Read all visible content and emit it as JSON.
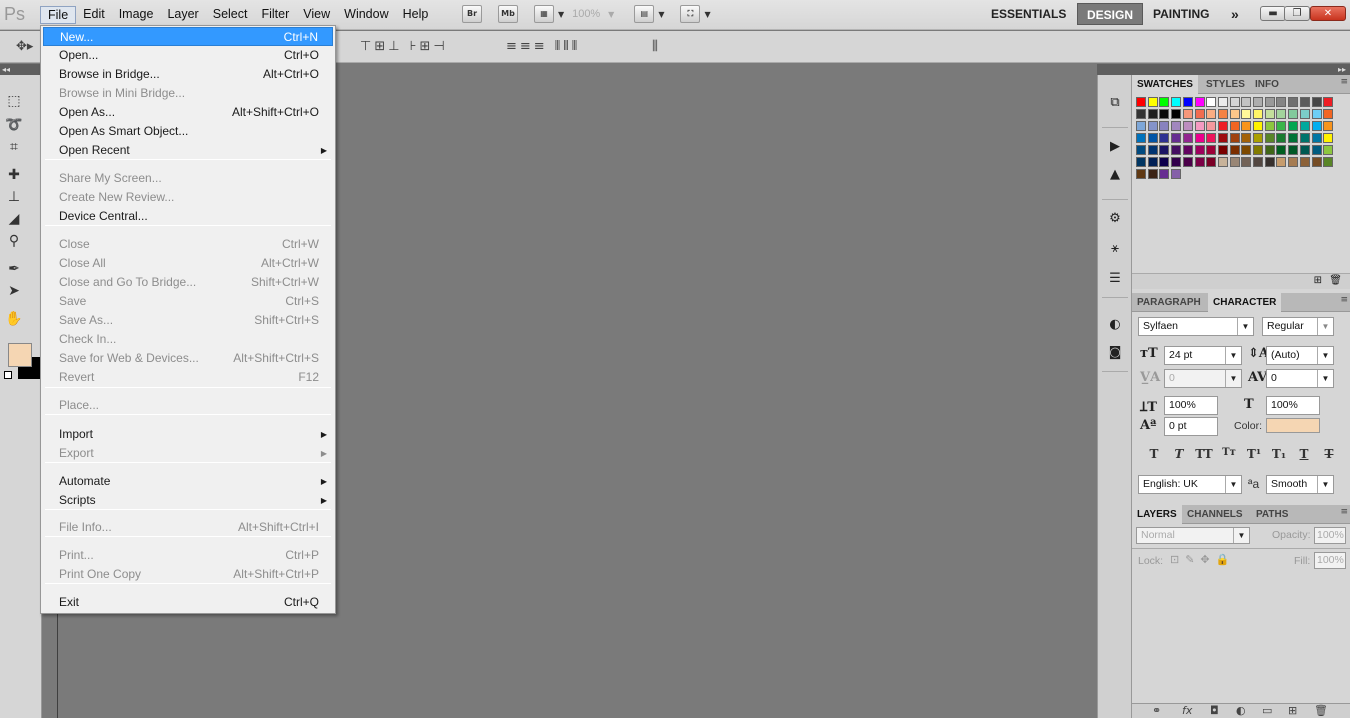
{
  "app": {
    "logo": "Ps"
  },
  "menubar": {
    "items": [
      "File",
      "Edit",
      "Image",
      "Layer",
      "Select",
      "Filter",
      "View",
      "Window",
      "Help"
    ]
  },
  "appbar": {
    "bridge": "Br",
    "minibridge": "Mb",
    "zoom": "100%"
  },
  "workspaces": {
    "essentials": "ESSENTIALS",
    "design": "DESIGN",
    "painting": "PAINTING",
    "more": "»"
  },
  "window_controls": {
    "minimize": "▬",
    "restore": "❐",
    "close": "✕"
  },
  "file_menu": {
    "items": [
      {
        "label": "New...",
        "shortcut": "Ctrl+N",
        "enabled": true,
        "highlighted": true
      },
      {
        "label": "Open...",
        "shortcut": "Ctrl+O",
        "enabled": true
      },
      {
        "label": "Browse in Bridge...",
        "shortcut": "Alt+Ctrl+O",
        "enabled": true
      },
      {
        "label": "Browse in Mini Bridge...",
        "shortcut": "",
        "enabled": false
      },
      {
        "label": "Open As...",
        "shortcut": "Alt+Shift+Ctrl+O",
        "enabled": true
      },
      {
        "label": "Open As Smart Object...",
        "shortcut": "",
        "enabled": true
      },
      {
        "label": "Open Recent",
        "shortcut": "",
        "enabled": true,
        "submenu": true
      },
      {
        "label": "Share My Screen...",
        "shortcut": "",
        "enabled": false
      },
      {
        "label": "Create New Review...",
        "shortcut": "",
        "enabled": false
      },
      {
        "label": "Device Central...",
        "shortcut": "",
        "enabled": true
      },
      {
        "label": "Close",
        "shortcut": "Ctrl+W",
        "enabled": false
      },
      {
        "label": "Close All",
        "shortcut": "Alt+Ctrl+W",
        "enabled": false
      },
      {
        "label": "Close and Go To Bridge...",
        "shortcut": "Shift+Ctrl+W",
        "enabled": false
      },
      {
        "label": "Save",
        "shortcut": "Ctrl+S",
        "enabled": false
      },
      {
        "label": "Save As...",
        "shortcut": "Shift+Ctrl+S",
        "enabled": false
      },
      {
        "label": "Check In...",
        "shortcut": "",
        "enabled": false
      },
      {
        "label": "Save for Web & Devices...",
        "shortcut": "Alt+Shift+Ctrl+S",
        "enabled": false
      },
      {
        "label": "Revert",
        "shortcut": "F12",
        "enabled": false
      },
      {
        "label": "Place...",
        "shortcut": "",
        "enabled": false
      },
      {
        "label": "Import",
        "shortcut": "",
        "enabled": true,
        "submenu": true
      },
      {
        "label": "Export",
        "shortcut": "",
        "enabled": false,
        "submenu": true
      },
      {
        "label": "Automate",
        "shortcut": "",
        "enabled": true,
        "submenu": true
      },
      {
        "label": "Scripts",
        "shortcut": "",
        "enabled": true,
        "submenu": true
      },
      {
        "label": "File Info...",
        "shortcut": "Alt+Shift+Ctrl+I",
        "enabled": false
      },
      {
        "label": "Print...",
        "shortcut": "Ctrl+P",
        "enabled": false
      },
      {
        "label": "Print One Copy",
        "shortcut": "Alt+Shift+Ctrl+P",
        "enabled": false
      },
      {
        "label": "Exit",
        "shortcut": "Ctrl+Q",
        "enabled": true
      }
    ]
  },
  "swatches_panel": {
    "tabs": [
      "SWATCHES",
      "STYLES",
      "INFO"
    ],
    "colors": [
      "#ff0000",
      "#ffff00",
      "#00ff00",
      "#00ffff",
      "#0000ff",
      "#ff00ff",
      "#ffffff",
      "#ebebeb",
      "#d6d6d6",
      "#c2c2c2",
      "#adadad",
      "#999999",
      "#858585",
      "#707070",
      "#5c5c5c",
      "#474747",
      "#ee1d24",
      "#333333",
      "#1f1f1f",
      "#0a0a0a",
      "#000000",
      "#f7977a",
      "#f26c4f",
      "#fbad82",
      "#f58345",
      "#fdc68a",
      "#fff79a",
      "#fff467",
      "#c4df9b",
      "#a3d39c",
      "#82ca9c",
      "#7bcdc8",
      "#6ecff6",
      "#f26522",
      "#7ea7d8",
      "#8493ca",
      "#8882be",
      "#a187be",
      "#bc8dbf",
      "#f49ac1",
      "#f5989d",
      "#ed1c24",
      "#f26522",
      "#f7941d",
      "#fff200",
      "#8dc63f",
      "#39b54a",
      "#00a651",
      "#00a99d",
      "#00aeef",
      "#f7941d",
      "#0072bc",
      "#0054a6",
      "#2e3192",
      "#662d91",
      "#92278f",
      "#ec008c",
      "#ed145b",
      "#9e0b0f",
      "#a0410d",
      "#a36209",
      "#aba000",
      "#598527",
      "#1a7b30",
      "#007236",
      "#00746b",
      "#0076a3",
      "#fff200",
      "#004a80",
      "#003471",
      "#1b1464",
      "#440e62",
      "#630460",
      "#9e005d",
      "#9e0039",
      "#790000",
      "#7b2e00",
      "#7d4900",
      "#827b00",
      "#406618",
      "#005e20",
      "#005826",
      "#005952",
      "#005b7f",
      "#8dc63f",
      "#003663",
      "#002157",
      "#0d004c",
      "#32004b",
      "#4b0049",
      "#7b0046",
      "#7a0026",
      "#c7b299",
      "#998675",
      "#736357",
      "#534741",
      "#37302d",
      "#c69c6d",
      "#a67c52",
      "#8c6239",
      "#754c24",
      "#598527",
      "#603913",
      "#3c2415",
      "#662d91",
      "#8560a8"
    ]
  },
  "character_panel": {
    "tabs": [
      "PARAGRAPH",
      "CHARACTER"
    ],
    "font_family": "Sylfaen",
    "font_style": "Regular",
    "size": "24 pt",
    "leading": "(Auto)",
    "kerning": "0",
    "tracking": "0",
    "vertical_scale": "100%",
    "horizontal_scale": "100%",
    "baseline_shift": "0 pt",
    "color_label": "Color:",
    "text_color": "#f5d6b3",
    "language": "English: UK",
    "aa_label": "ªa",
    "antialias": "Smooth"
  },
  "layers_panel": {
    "tabs": [
      "LAYERS",
      "CHANNELS",
      "PATHS"
    ],
    "blend_mode": "Normal",
    "opacity_label": "Opacity:",
    "opacity": "100%",
    "lock_label": "Lock:",
    "fill_label": "Fill:",
    "fill": "100%"
  },
  "toolbox": {
    "foreground_color": "#f5d6b3",
    "background_color": "#000000"
  }
}
